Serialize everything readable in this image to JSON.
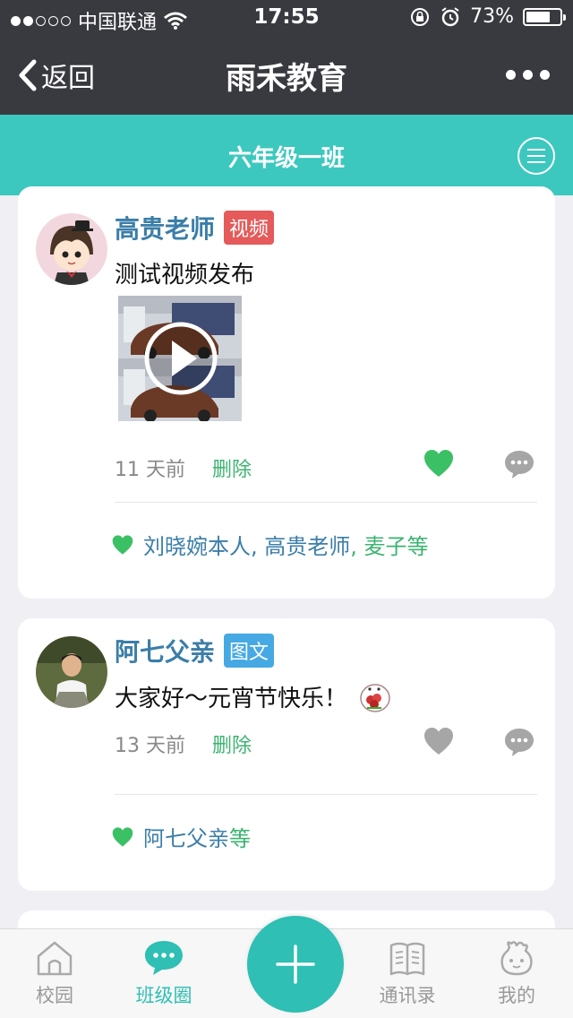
{
  "status_bar": {
    "carrier": "中国联通",
    "time": "17:55",
    "battery": "73%",
    "battery_level": 0.73
  },
  "nav": {
    "back_label": "返回",
    "title": "雨禾教育"
  },
  "class_header": {
    "title": "六年级一班"
  },
  "posts": [
    {
      "author": "高贵老师",
      "type_badge": "视频",
      "text": "测试视频发布",
      "time": "11 天前",
      "delete_label": "删除",
      "liked": true,
      "likers": "刘晓婉本人, 高贵老师",
      "likers_suffix": ", 麦子等"
    },
    {
      "author": "阿七父亲",
      "type_badge": "图文",
      "text": "大家好～元宵节快乐！",
      "time": "13 天前",
      "delete_label": "删除",
      "liked": false,
      "likers": "阿七父亲",
      "likers_suffix": "等"
    }
  ],
  "tabbar": {
    "items": [
      {
        "label": "校园",
        "icon": "house-icon",
        "active": false
      },
      {
        "label": "班级圈",
        "icon": "chat-bubble-icon",
        "active": true
      },
      {
        "label": "通讯录",
        "icon": "book-icon",
        "active": false
      },
      {
        "label": "我的",
        "icon": "profile-icon",
        "active": false
      }
    ],
    "fab_icon": "plus-icon"
  },
  "colors": {
    "header_dark": "#393a3f",
    "teal": "#3cc8bf",
    "like_green": "#3cb371",
    "name_blue": "#3b7ea8",
    "badge_video": "#e55a5a",
    "badge_text": "#46a9e4"
  }
}
